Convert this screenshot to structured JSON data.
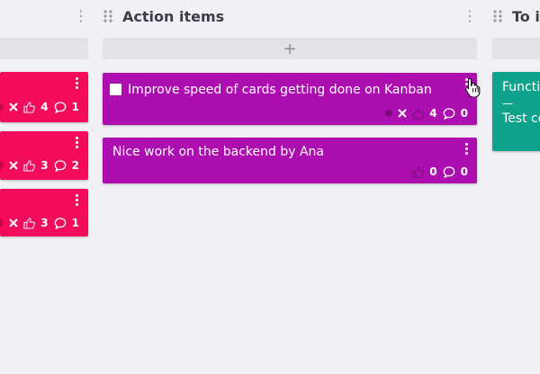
{
  "columns": [
    {
      "title": ""
    },
    {
      "title": "Action items",
      "add_label": "+"
    },
    {
      "title": "To in"
    }
  ],
  "left_cards": [
    {
      "likes": "4",
      "comments": "1"
    },
    {
      "likes": "3",
      "comments": "2"
    },
    {
      "likes": "3",
      "comments": "1"
    }
  ],
  "action_cards": [
    {
      "text": "Improve speed of cards getting done on Kanban",
      "likes": "4",
      "comments": "0"
    },
    {
      "text": "Nice work on the backend by Ana",
      "likes": "0",
      "comments": "0"
    }
  ],
  "right_card": {
    "line1": "Functio",
    "line2": "—",
    "line3": "Test co"
  },
  "colors": {
    "red": "#f40b5b",
    "purple": "#ad0eb0",
    "teal": "#10a28a"
  }
}
